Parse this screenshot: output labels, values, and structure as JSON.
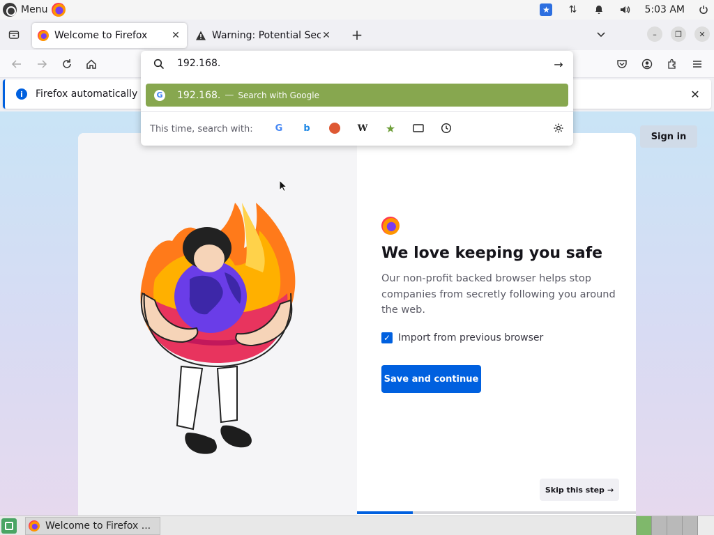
{
  "system": {
    "menu_label": "Menu",
    "clock": "5:03 AM"
  },
  "tabs": [
    {
      "title": "Welcome to Firefox",
      "active": true
    },
    {
      "title": "Warning: Potential Security Risk Ahead",
      "active": false
    }
  ],
  "notification": {
    "text": "Firefox automatically se"
  },
  "urlbar": {
    "value": "192.168.",
    "suggestion_text": "192.168.",
    "suggestion_separator": "—",
    "suggestion_action": "Search with Google",
    "oneoff_label": "This time, search with:",
    "engines": [
      "google-icon",
      "bing-icon",
      "duckduckgo-icon",
      "wikipedia-icon",
      "bookmarks-icon",
      "tabs-icon",
      "history-icon"
    ]
  },
  "page": {
    "signin": "Sign in",
    "title": "We love keeping you safe",
    "description": "Our non-profit backed browser helps stop companies from secretly following you around the web.",
    "import_label": "Import from previous browser",
    "import_checked": true,
    "primary_button": "Save and continue",
    "skip_button": "Skip this step",
    "progress": 0.2
  },
  "taskbar": {
    "item_label": "Welcome to Firefox ..."
  },
  "colors": {
    "accent": "#0060df",
    "suggestion_highlight": "#87a74f"
  }
}
